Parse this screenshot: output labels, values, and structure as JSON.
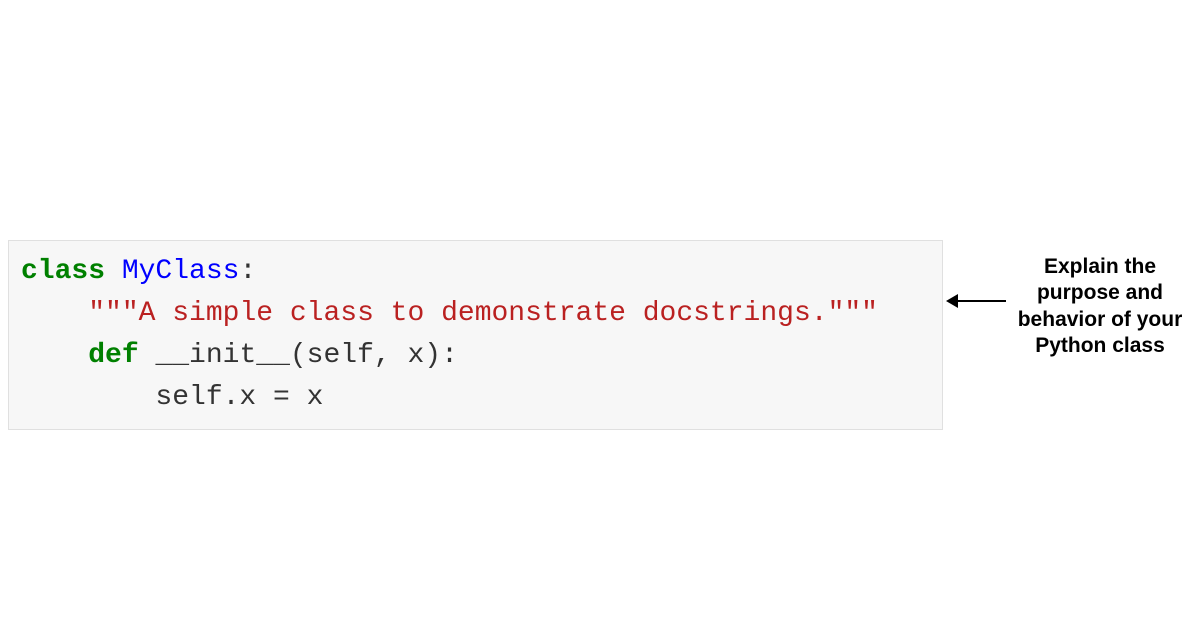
{
  "code": {
    "kw_class": "class",
    "class_name": "MyClass",
    "colon1": ":",
    "indent1": "    ",
    "docstring_open": "\"\"\"",
    "docstring_text": "A simple class to demonstrate docstrings.",
    "docstring_close": "\"\"\"",
    "blank": "",
    "kw_def": "def",
    "func_name": "__init__",
    "func_params": "(self, x):",
    "indent2": "        ",
    "body_line": "self.x = x"
  },
  "annotation": {
    "text": "Explain the purpose and behavior of your Python class"
  }
}
